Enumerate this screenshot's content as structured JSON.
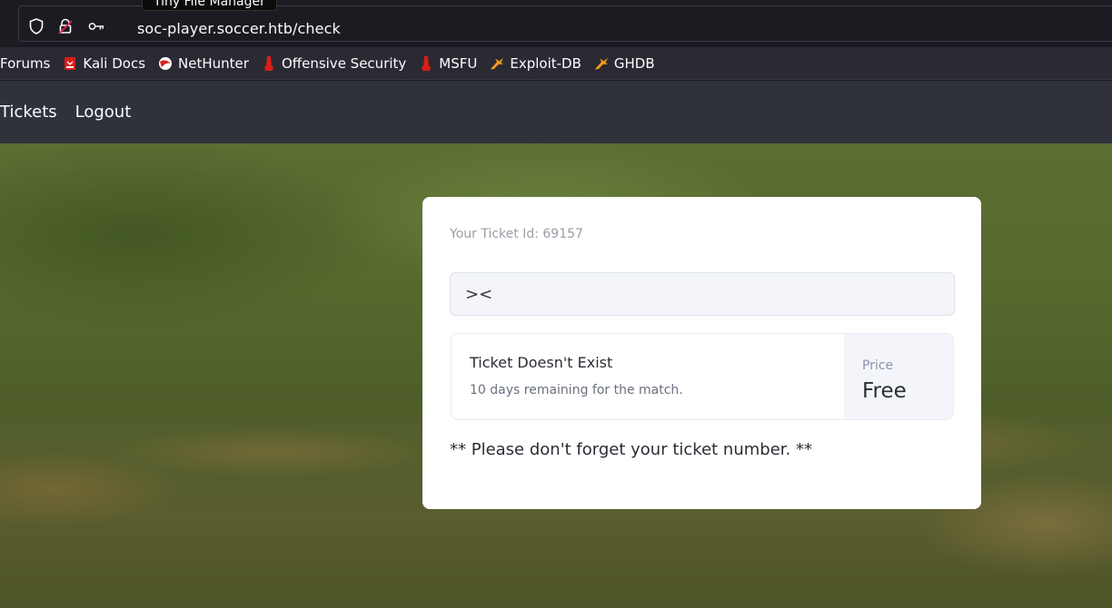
{
  "browser": {
    "url": "soc-player.soccer.htb/check",
    "tooltip": "Tiny File Manager"
  },
  "bookmarks": [
    {
      "label": "Forums",
      "icon": "none"
    },
    {
      "label": "Kali Docs",
      "icon": "kali-docs-icon"
    },
    {
      "label": "NetHunter",
      "icon": "nethunter-icon"
    },
    {
      "label": "Offensive Security",
      "icon": "offsec-icon"
    },
    {
      "label": "MSFU",
      "icon": "offsec-icon"
    },
    {
      "label": "Exploit-DB",
      "icon": "exploit-db-icon"
    },
    {
      "label": "GHDB",
      "icon": "exploit-db-icon"
    }
  ],
  "nav": {
    "tickets": "Tickets",
    "logout": "Logout"
  },
  "card": {
    "ticket_id_text": "Your Ticket Id: 69157",
    "input_value": "><",
    "result_title": "Ticket Doesn't Exist",
    "result_subtitle": "10 days remaining for the match.",
    "price_label": "Price",
    "price_value": "Free",
    "note": "** Please don't forget your ticket number. **"
  },
  "colors": {
    "toolbar_bg": "#1c1b22",
    "bookmarks_bg": "#2b2a33",
    "nav_bg": "#2f323b",
    "card_bg": "#ffffff",
    "kali_red": "#d91e18",
    "exploitdb_orange": "#f59b1d"
  }
}
